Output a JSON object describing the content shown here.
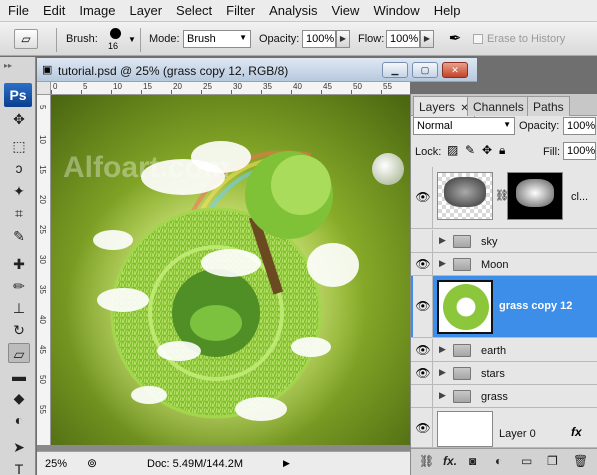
{
  "menu": [
    "File",
    "Edit",
    "Image",
    "Layer",
    "Select",
    "Filter",
    "Analysis",
    "View",
    "Window",
    "Help"
  ],
  "options": {
    "brush_label": "Brush:",
    "brush_size": "16",
    "mode_label": "Mode:",
    "mode_value": "Brush",
    "opacity_label": "Opacity:",
    "opacity_value": "100%",
    "flow_label": "Flow:",
    "flow_value": "100%",
    "erase_history_label": "Erase to History"
  },
  "tools": {
    "logo": "Ps",
    "icons": [
      "move-icon",
      "marquee-icon",
      "lasso-icon",
      "magic-wand-icon",
      "crop-icon",
      "eyedropper-icon",
      "healing-brush-icon",
      "brush-icon",
      "clone-stamp-icon",
      "history-brush-icon",
      "eraser-icon",
      "gradient-icon",
      "blur-icon",
      "dodge-icon",
      "path-selection-icon",
      "type-icon"
    ],
    "glyphs": [
      "✥",
      "⬚",
      "ↄ",
      "✦",
      "⌗",
      "✎",
      "✚",
      "✏",
      "⊥",
      "↻",
      "▱",
      "▬",
      "◆",
      "◐",
      "➤",
      "T"
    ]
  },
  "document": {
    "title": "tutorial.psd @ 25% (grass copy 12, RGB/8)",
    "watermark": "Alfoart.com",
    "zoom": "25%",
    "doc_size": "Doc: 5.49M/144.2M",
    "ruler_top": [
      "0",
      "5",
      "10",
      "15",
      "20",
      "25",
      "30",
      "35",
      "40",
      "45",
      "50",
      "55"
    ],
    "ruler_left": [
      "5",
      "10",
      "15",
      "20",
      "25",
      "30",
      "35",
      "40",
      "45",
      "50",
      "55"
    ]
  },
  "layers_panel": {
    "tabs": [
      "Layers",
      "Channels",
      "Paths"
    ],
    "blend_mode": "Normal",
    "opacity_label": "Opacity:",
    "opacity_value": "100%",
    "lock_label": "Lock:",
    "fill_label": "Fill:",
    "fill_value": "100%",
    "layers": [
      {
        "name": "cl...",
        "visible": true,
        "type": "masked"
      },
      {
        "name": "sky",
        "visible": false,
        "type": "group"
      },
      {
        "name": "Moon",
        "visible": true,
        "type": "group"
      },
      {
        "name": "grass copy 12",
        "visible": true,
        "type": "layer",
        "selected": true
      },
      {
        "name": "earth",
        "visible": true,
        "type": "group"
      },
      {
        "name": "stars",
        "visible": true,
        "type": "group"
      },
      {
        "name": "grass",
        "visible": false,
        "type": "group"
      },
      {
        "name": "Layer 0",
        "visible": true,
        "type": "layer"
      }
    ]
  },
  "colors": {
    "selection": "#3d8ee8",
    "canvas_bg": "#6b8f1c",
    "grass": "#8cc63a"
  }
}
